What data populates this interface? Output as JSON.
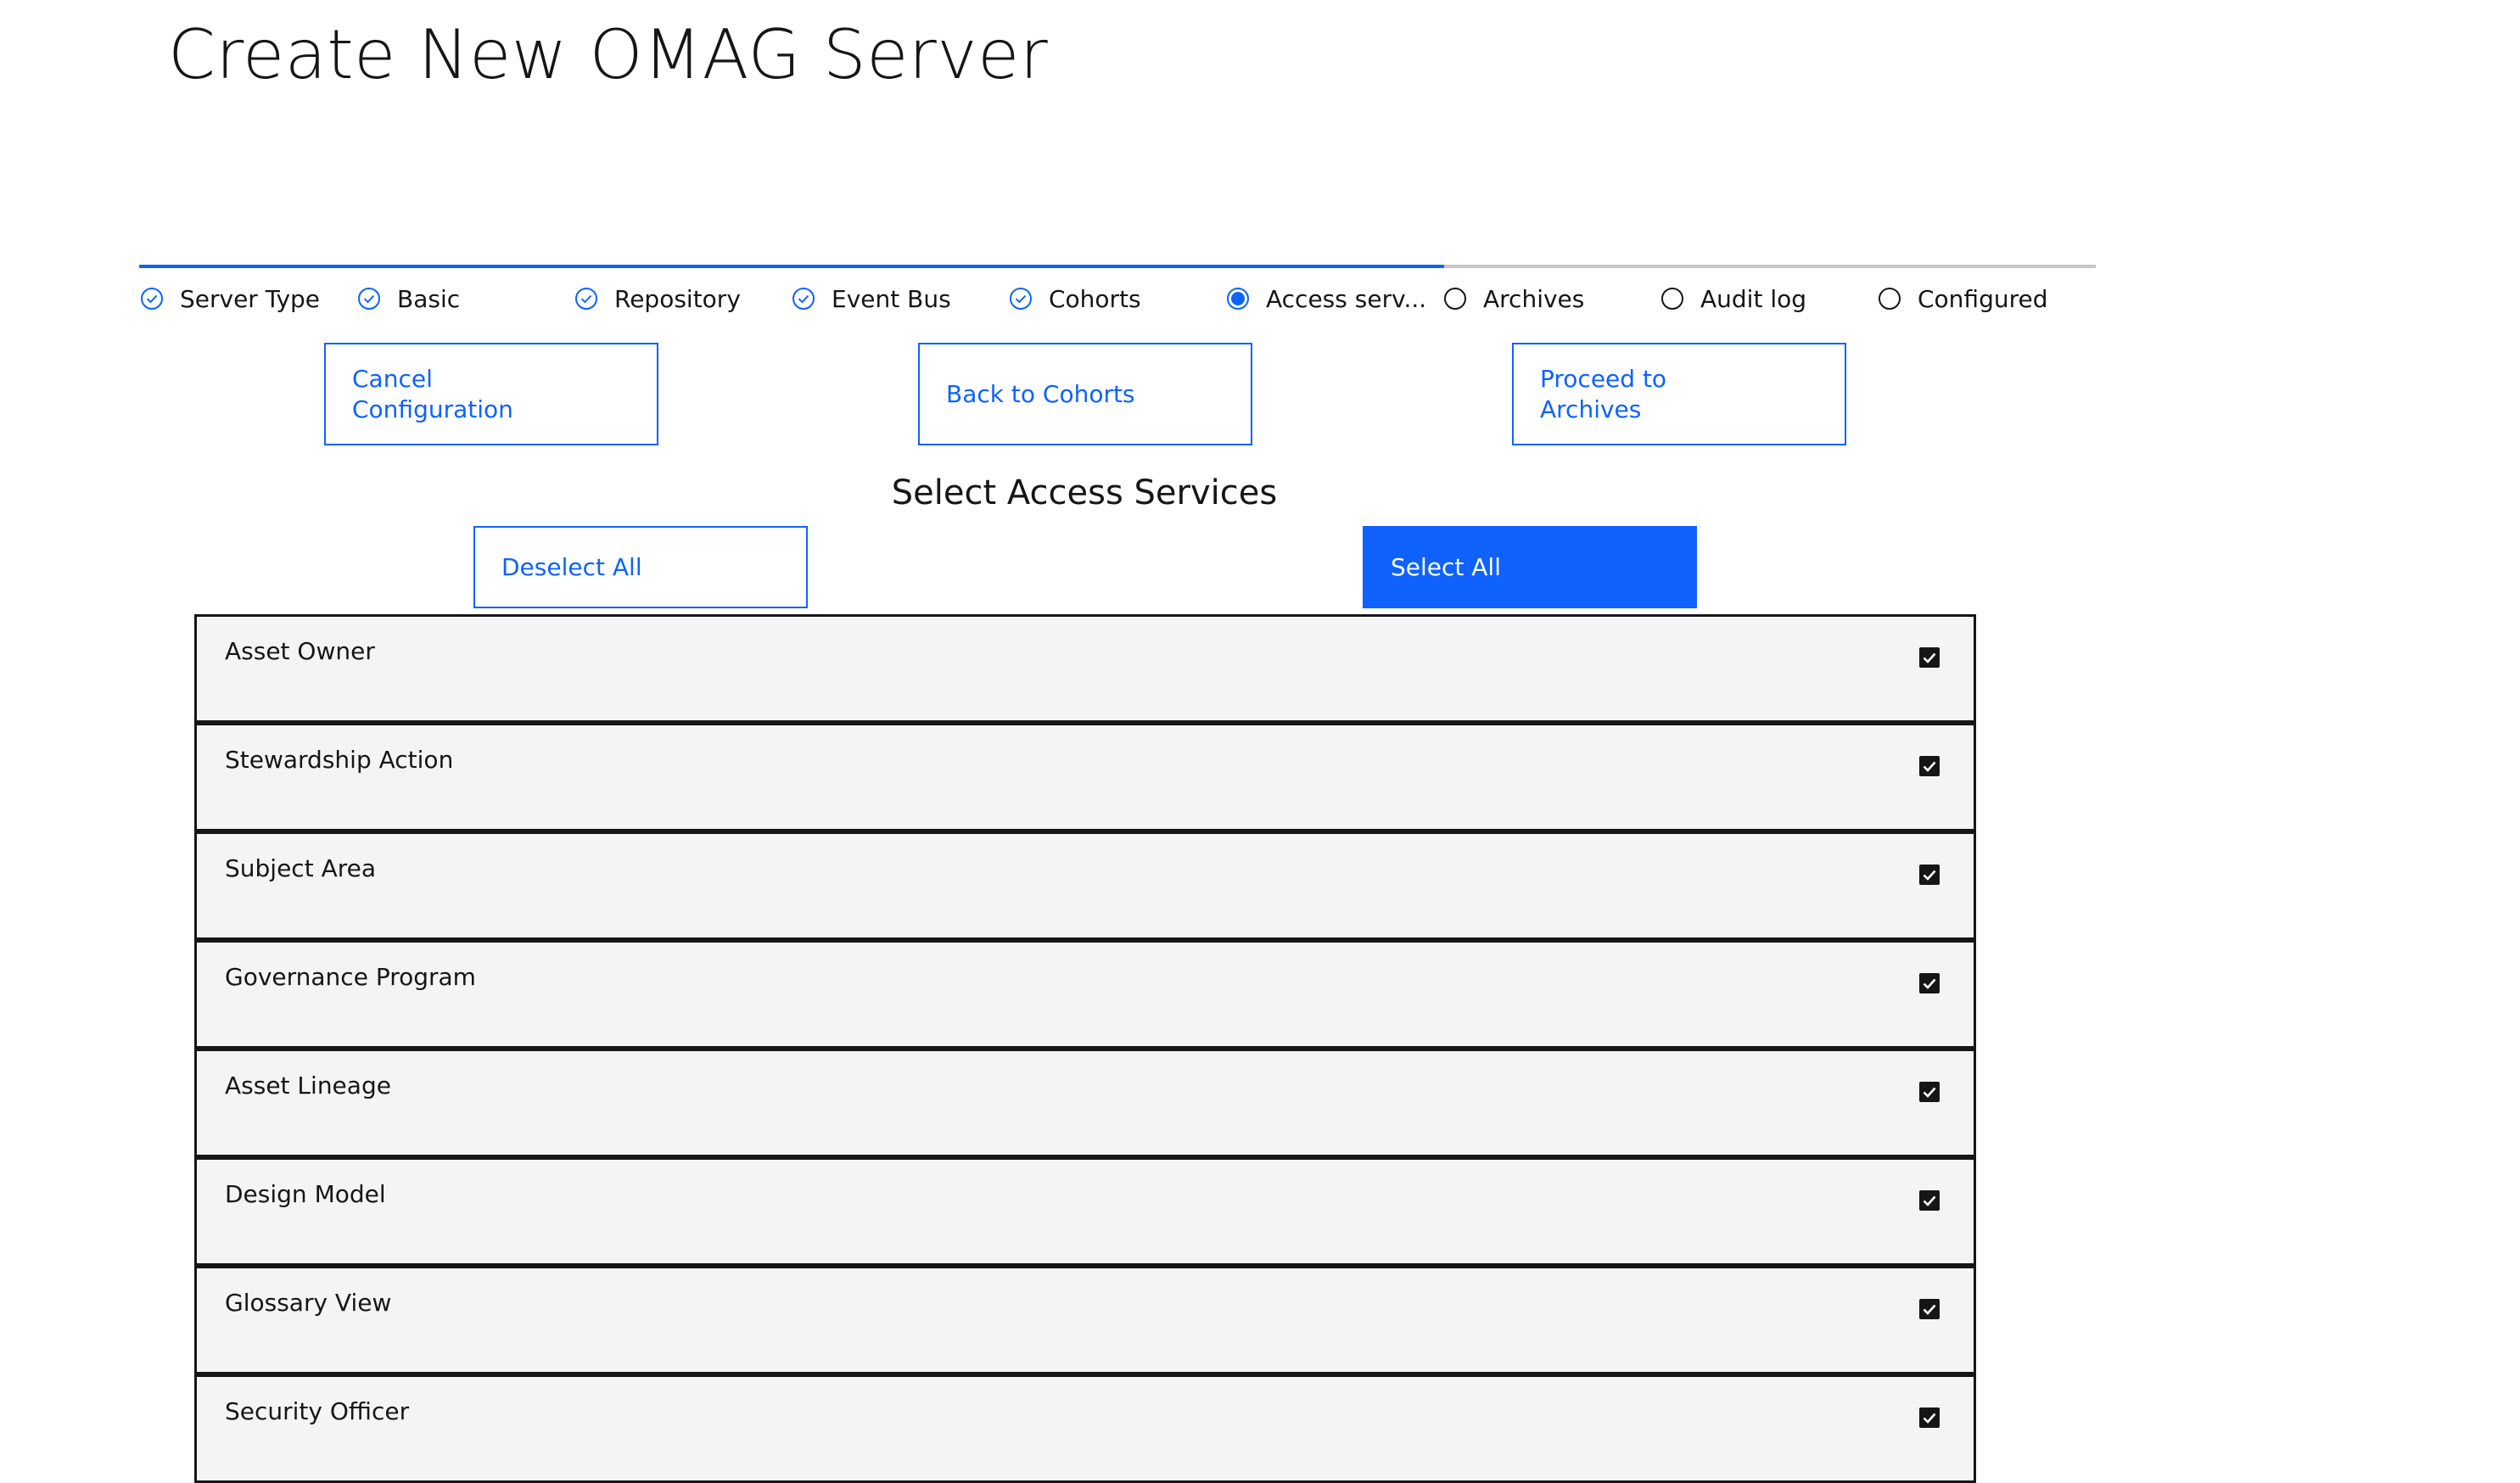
{
  "page": {
    "title": "Create New OMAG Server"
  },
  "colors": {
    "accent": "#0f62fe",
    "text": "#161616",
    "row_background": "#f4f4f4",
    "track": "#c6c6c6"
  },
  "progress": {
    "completed_fraction": 0.667,
    "steps": [
      {
        "label": "Server Type",
        "state": "complete",
        "icon": "checkmark-outline-icon"
      },
      {
        "label": "Basic",
        "state": "complete",
        "icon": "checkmark-outline-icon"
      },
      {
        "label": "Repository",
        "state": "complete",
        "icon": "checkmark-outline-icon"
      },
      {
        "label": "Event Bus",
        "state": "complete",
        "icon": "checkmark-outline-icon"
      },
      {
        "label": "Cohorts",
        "state": "complete",
        "icon": "checkmark-outline-icon"
      },
      {
        "label": "Access serv...",
        "state": "current",
        "icon": "radio-filled-icon"
      },
      {
        "label": "Archives",
        "state": "incomplete",
        "icon": "radio-empty-icon"
      },
      {
        "label": "Audit log",
        "state": "incomplete",
        "icon": "radio-empty-icon"
      },
      {
        "label": "Configured",
        "state": "incomplete",
        "icon": "radio-empty-icon"
      }
    ]
  },
  "actions": {
    "cancel_label": "Cancel\nConfiguration",
    "back_label": "Back to Cohorts",
    "proceed_label": "Proceed to\nArchives"
  },
  "section": {
    "title": "Select Access Services",
    "deselect_all_label": "Deselect All",
    "select_all_label": "Select All"
  },
  "services": [
    {
      "label": "Asset Owner",
      "checked": true
    },
    {
      "label": "Stewardship Action",
      "checked": true
    },
    {
      "label": "Subject Area",
      "checked": true
    },
    {
      "label": "Governance Program",
      "checked": true
    },
    {
      "label": "Asset Lineage",
      "checked": true
    },
    {
      "label": "Design Model",
      "checked": true
    },
    {
      "label": "Glossary View",
      "checked": true
    },
    {
      "label": "Security Officer",
      "checked": true
    }
  ]
}
